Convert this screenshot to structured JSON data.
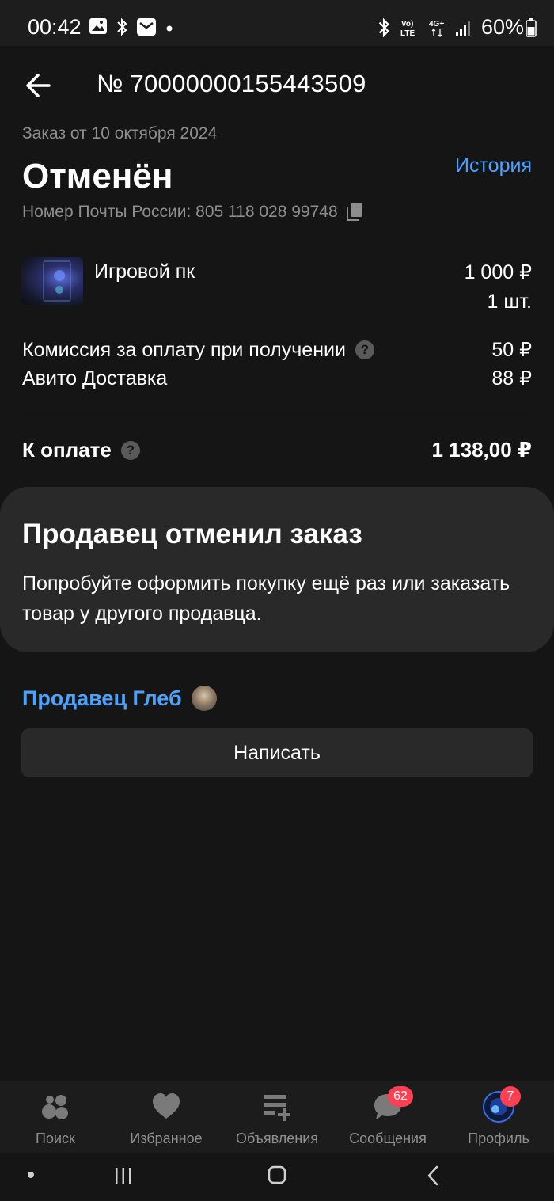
{
  "status_bar": {
    "time": "00:42",
    "battery": "60%"
  },
  "header": {
    "order_number": "№ 70000000155443509"
  },
  "order": {
    "date": "Заказ от 10 октября 2024",
    "status": "Отменён",
    "history_link": "История",
    "tracking": "Номер Почты России: 805 118 028 99748"
  },
  "item": {
    "title": "Игровой пк",
    "price": "1 000 ₽",
    "quantity": "1 шт."
  },
  "fees": [
    {
      "label": "Комиссия за оплату при получении",
      "value": "50 ₽"
    },
    {
      "label": "Авито Доставка",
      "value": "88 ₽"
    }
  ],
  "total": {
    "label": "К оплате",
    "value": "1 138,00 ₽"
  },
  "notice": {
    "title": "Продавец отменил заказ",
    "text": "Попробуйте оформить покупку ещё раз или заказать товар у другого продавца."
  },
  "seller": {
    "name": "Продавец Глеб",
    "write_button": "Написать"
  },
  "tabs": [
    {
      "label": "Поиск",
      "icon": "search-icon"
    },
    {
      "label": "Избранное",
      "icon": "heart-icon"
    },
    {
      "label": "Объявления",
      "icon": "ads-icon"
    },
    {
      "label": "Сообщения",
      "icon": "chat-icon",
      "badge": "62"
    },
    {
      "label": "Профиль",
      "icon": "profile-icon",
      "badge": "7"
    }
  ],
  "colors": {
    "background": "#151515",
    "accent_link": "#4ba3ff",
    "card": "#292929",
    "badge": "#ff4053"
  }
}
